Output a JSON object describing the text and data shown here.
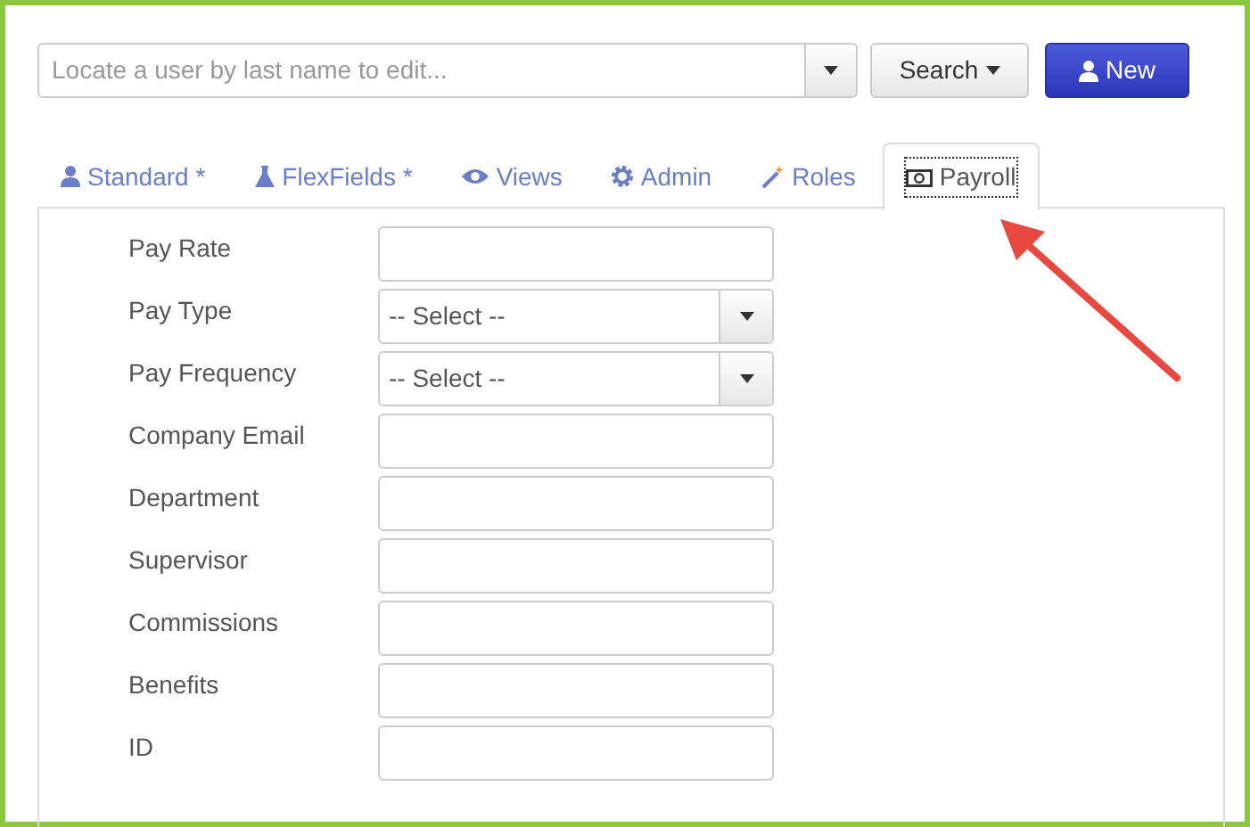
{
  "search": {
    "placeholder": "Locate a user by last name to edit...",
    "search_button": "Search",
    "new_button": "New"
  },
  "tabs": [
    {
      "label": "Standard *",
      "selected": false
    },
    {
      "label": "FlexFields *",
      "selected": false
    },
    {
      "label": "Views",
      "selected": false
    },
    {
      "label": "Admin",
      "selected": false
    },
    {
      "label": "Roles",
      "selected": false
    },
    {
      "label": "Payroll",
      "selected": true
    }
  ],
  "fields": [
    {
      "label": "Pay Rate",
      "kind": "text"
    },
    {
      "label": "Pay Type",
      "kind": "select",
      "value": "-- Select --"
    },
    {
      "label": "Pay Frequency",
      "kind": "select",
      "value": "-- Select --"
    },
    {
      "label": "Company Email",
      "kind": "text"
    },
    {
      "label": "Department",
      "kind": "text"
    },
    {
      "label": "Supervisor",
      "kind": "text"
    },
    {
      "label": "Commissions",
      "kind": "text"
    },
    {
      "label": "Benefits",
      "kind": "text"
    },
    {
      "label": "ID",
      "kind": "text"
    }
  ]
}
